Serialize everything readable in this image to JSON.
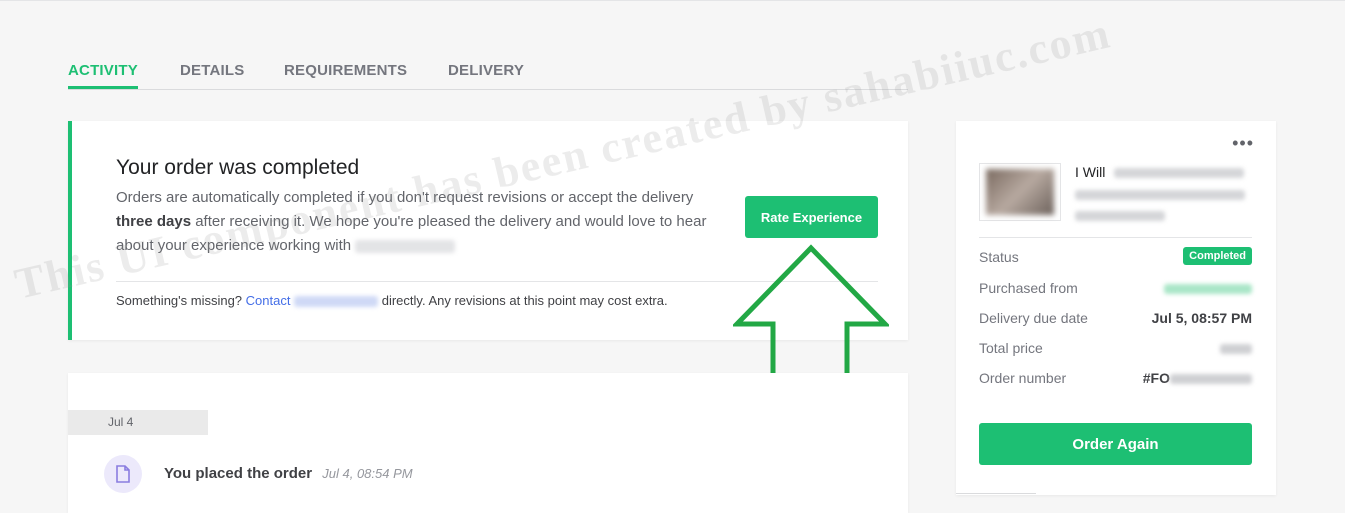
{
  "tabs": [
    {
      "label": "ACTIVITY",
      "active": true
    },
    {
      "label": "DETAILS",
      "active": false
    },
    {
      "label": "REQUIREMENTS",
      "active": false
    },
    {
      "label": "DELIVERY",
      "active": false
    }
  ],
  "completed_card": {
    "title": "Your order was completed",
    "body_part1": "Orders are automatically completed if you don't request revisions or accept the delivery",
    "body_bold": "three days",
    "body_part2": "after receiving it. We hope you're pleased the delivery and would love to hear about your experience working with",
    "rate_button": "Rate Experience",
    "footer_prefix": "Something's missing?",
    "footer_link": "Contact",
    "footer_suffix": "directly. Any revisions at this point may cost extra."
  },
  "activity": {
    "date_chip": "Jul 4",
    "event_text": "You placed the order",
    "event_time": "Jul 4, 08:54 PM"
  },
  "order_summary": {
    "menu_icon": "more-dots-icon",
    "gig_title_visible": "I Will",
    "status_label": "Status",
    "status_value": "Completed",
    "purchased_from_label": "Purchased from",
    "delivery_due_label": "Delivery due date",
    "delivery_due_value": "Jul 5, 08:57 PM",
    "total_price_label": "Total price",
    "order_number_label": "Order number",
    "order_number_prefix": "#FO",
    "order_again_button": "Order Again"
  },
  "watermark": "This UI component has been created by sahabiiuc.com",
  "colors": {
    "accent": "#1dbf73",
    "link": "#446ee7",
    "annotation_arrow": "#22a845"
  }
}
